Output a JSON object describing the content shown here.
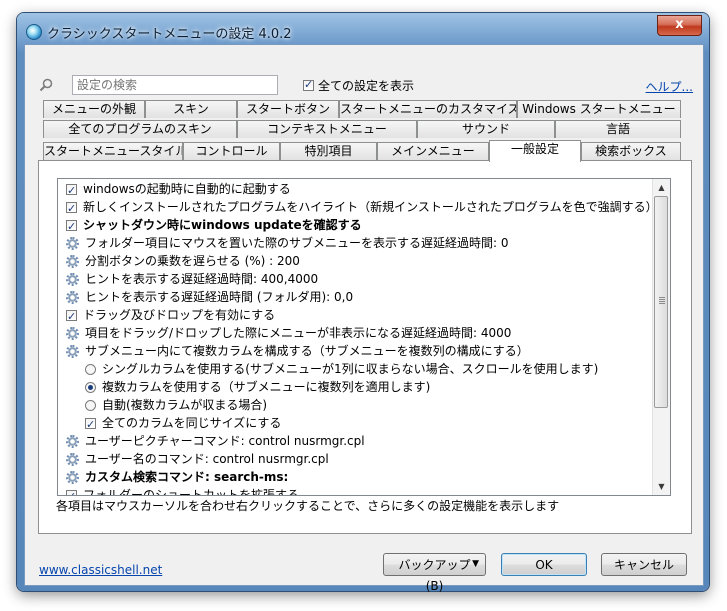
{
  "window": {
    "title": "クラシックスタートメニューの設定 4.0.2",
    "close_label": "x"
  },
  "search": {
    "placeholder": "設定の検索"
  },
  "show_all": {
    "label": "全ての設定を表示",
    "checked": true
  },
  "help_link": "ヘルプ...",
  "tabs": {
    "row1": [
      "メニューの外観",
      "スキン",
      "スタートボタン",
      "スタートメニューのカスタマイズ",
      "Windows スタートメニュー"
    ],
    "row2": [
      "全てのプログラムのスキン",
      "コンテキストメニュー",
      "サウンド",
      "言語"
    ],
    "row3": [
      "スタートメニュースタイル",
      "コントロール",
      "特別項目",
      "メインメニュー",
      "一般設定",
      "検索ボックス"
    ],
    "active": "一般設定"
  },
  "settings": [
    {
      "type": "check",
      "checked": true,
      "bold": false,
      "indent": 0,
      "label": "windowsの起動時に自動的に起動する"
    },
    {
      "type": "check",
      "checked": true,
      "bold": false,
      "indent": 0,
      "label": "新しくインストールされたプログラムをハイライト（新規インストールされたプログラムを色で強調する）"
    },
    {
      "type": "check",
      "checked": true,
      "bold": true,
      "indent": 0,
      "label": "シャットダウン時にwindows updateを確認する"
    },
    {
      "type": "gear",
      "bold": false,
      "indent": 0,
      "label": "フォルダー項目にマウスを置いた際のサブメニューを表示する遅延経過時間: 0"
    },
    {
      "type": "gear",
      "bold": false,
      "indent": 0,
      "label": "分割ボタンの乗数を遅らせる (%) : 200"
    },
    {
      "type": "gear",
      "bold": false,
      "indent": 0,
      "label": "ヒントを表示する遅延経過時間: 400,4000"
    },
    {
      "type": "gear",
      "bold": false,
      "indent": 0,
      "label": "ヒントを表示する遅延経過時間 (フォルダ用): 0,0"
    },
    {
      "type": "check",
      "checked": true,
      "bold": false,
      "indent": 0,
      "label": "ドラッグ及びドロップを有効にする"
    },
    {
      "type": "gear",
      "bold": false,
      "indent": 0,
      "label": "項目をドラッグ/ドロップした際にメニューが非表示になる遅延経過時間: 4000"
    },
    {
      "type": "gear",
      "bold": false,
      "indent": 0,
      "label": "サブメニュー内にて複数カラムを構成する（サブメニューを複数列の構成にする）"
    },
    {
      "type": "radio",
      "checked": false,
      "bold": false,
      "indent": 1,
      "label": "シングルカラムを使用する(サブメニューが1列に収まらない場合、スクロールを使用します)"
    },
    {
      "type": "radio",
      "checked": true,
      "bold": false,
      "indent": 1,
      "label": "複数カラムを使用する（サブメニューに複数列を適用します)"
    },
    {
      "type": "radio",
      "checked": false,
      "bold": false,
      "indent": 1,
      "label": "自動(複数カラムが収まる場合)"
    },
    {
      "type": "check",
      "checked": true,
      "bold": false,
      "indent": 1,
      "label": "全てのカラムを同じサイズにする"
    },
    {
      "type": "gear",
      "bold": false,
      "indent": 0,
      "label": "ユーザーピクチャーコマンド: control nusrmgr.cpl"
    },
    {
      "type": "gear",
      "bold": false,
      "indent": 0,
      "label": "ユーザー名のコマンド: control nusrmgr.cpl"
    },
    {
      "type": "gear",
      "bold": true,
      "indent": 0,
      "label": "カスタム検索コマンド: search-ms:"
    },
    {
      "type": "check",
      "checked": true,
      "bold": false,
      "indent": 0,
      "label": "フォルダーのショートカットを拡張する"
    }
  ],
  "status_text": "各項目はマウスカーソルを合わせ右クリックすることで、さらに多くの設定機能を表示します",
  "footer": {
    "link": "www.classicshell.net",
    "backup_label": "バックアップ(B)",
    "ok_label": "OK",
    "cancel_label": "キャンセル"
  }
}
